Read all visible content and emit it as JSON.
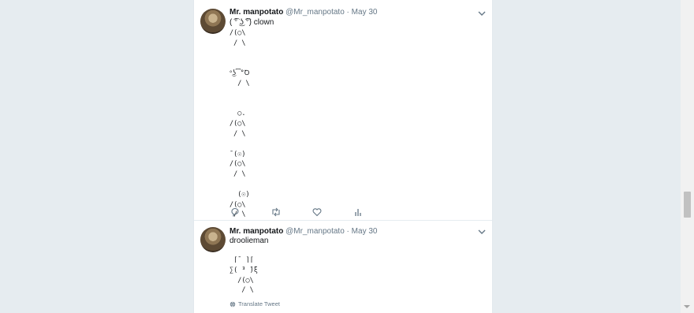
{
  "tweets": [
    {
      "name": "Mr. manpotato",
      "handle": "@Mr_manpotato",
      "dot": "·",
      "date": "May 30",
      "text": "( ͡° ͜ʖ ͡°) clown",
      "art": "/(◯\\\n / \\\n\n\n°͜ʖ͡°Ꝺ\n  / \\\n\n\n  ◯.\n/(◯\\\n / \\\n\n¯(☉)\n/(◯\\\n / \\\n\n  (☉)\n/(◯\\\n / \\"
    },
    {
      "name": "Mr. manpotato",
      "handle": "@Mr_manpotato",
      "dot": "·",
      "date": "May 30",
      "text": "droolieman",
      "art": " ⌈¯ ⌉⌈\n∑( ̄³ ̄)ξ\n  /(◯\\\n   / \\",
      "translate": "Translate Tweet"
    }
  ],
  "icons": {
    "reply": "reply-icon",
    "retweet": "retweet-icon",
    "like": "like-icon",
    "analytics": "analytics-icon",
    "caret": "chevron-down-icon",
    "globe": "globe-icon"
  },
  "colors": {
    "background": "#e6ecf0",
    "secondary_text": "#657786",
    "action_icon": "#657786"
  }
}
